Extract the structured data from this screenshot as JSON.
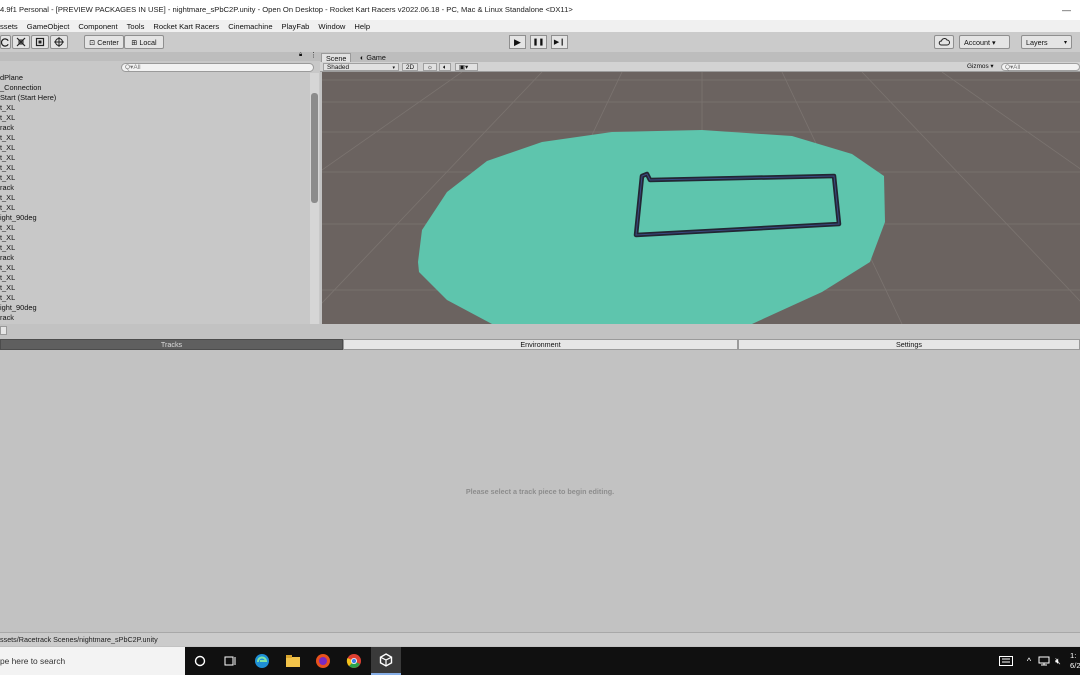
{
  "window": {
    "title": "4.9f1 Personal - [PREVIEW PACKAGES IN USE] - nightmare_sPbC2P.unity - Open On Desktop - Rocket Kart Racers v2022.06.18 - PC, Mac & Linux Standalone <DX11>",
    "minimize": "—",
    "close": "✕"
  },
  "menu": [
    "ssets",
    "GameObject",
    "Component",
    "Tools",
    "Rocket Kart Racers",
    "Cinemachine",
    "PlayFab",
    "Window",
    "Help"
  ],
  "toolbar": {
    "pivot_label": "Center",
    "space_label": "Local",
    "play_icon": "▶",
    "pause_icon": "❚❚",
    "step_icon": "▶❙",
    "account_label": "Account ▾",
    "layers_label": "Layers"
  },
  "hierarchy": {
    "search_placeholder": "Q▾All",
    "items": [
      "dPlane",
      "_Connection",
      "Start (Start Here)",
      "t_XL",
      "t_XL",
      "rack",
      "t_XL",
      "t_XL",
      "t_XL",
      "t_XL",
      "t_XL",
      "rack",
      "t_XL",
      "t_XL",
      "ight_90deg",
      "t_XL",
      "t_XL",
      "t_XL",
      "rack",
      "t_XL",
      "t_XL",
      "t_XL",
      "t_XL",
      "ight_90deg",
      "rack"
    ]
  },
  "scene": {
    "tab_scene": "Scene",
    "tab_game": "Game",
    "shading_mode": "Shaded",
    "mode_2d": "2D",
    "gizmos_label": "Gizmos ▾",
    "search_placeholder": "Q▾All",
    "ground_color": "#6b6360",
    "platform_color": "#5ec5ad",
    "track_color": "#222633"
  },
  "lower_tabs": [
    "Tracks",
    "Environment",
    "Settings"
  ],
  "lower_message": "Please select a track piece to begin editing.",
  "status": {
    "path": "ssets/Racetrack Scenes/nightmare_sPbC2P.unity"
  },
  "taskbar": {
    "search_placeholder": "pe here to search",
    "clock_time": "1:",
    "clock_date": "6/2"
  }
}
